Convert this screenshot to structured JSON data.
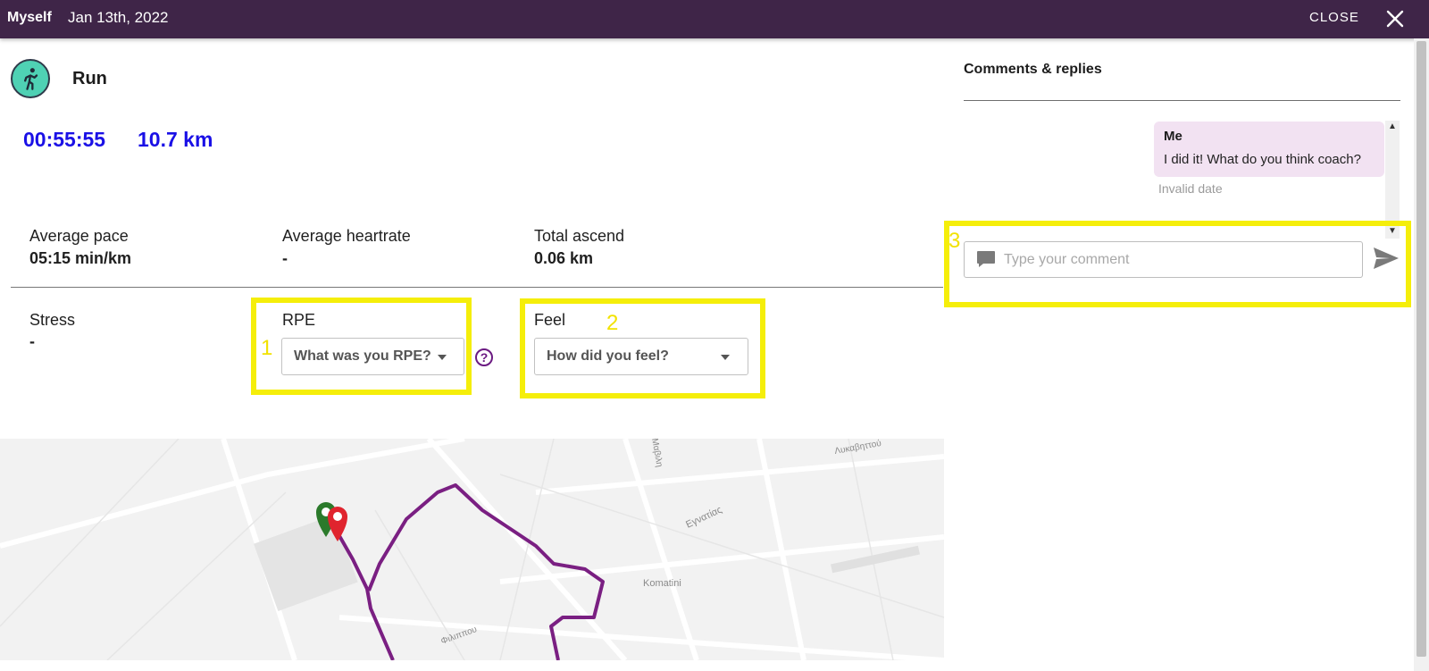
{
  "header": {
    "user": "Myself",
    "date": "Jan 13th, 2022",
    "close_label": "CLOSE"
  },
  "activity": {
    "title": "Run",
    "duration": "00:55:55",
    "distance": "10.7 km"
  },
  "stats": {
    "avg_pace_label": "Average pace",
    "avg_pace_value": "05:15 min/km",
    "avg_hr_label": "Average heartrate",
    "avg_hr_value": "-",
    "ascend_label": "Total ascend",
    "ascend_value": "0.06 km",
    "stress_label": "Stress",
    "stress_value": "-"
  },
  "rpe": {
    "label": "RPE",
    "placeholder": "What was you RPE?",
    "help": "?"
  },
  "feel": {
    "label": "Feel",
    "placeholder": "How did you feel?"
  },
  "annotations": [
    "1",
    "2",
    "3"
  ],
  "map": {
    "street_labels": [
      "Komatini",
      "Εγνατίας",
      "Λυκαβηττού",
      "Φιλιππου",
      "Μαβιλη"
    ]
  },
  "comments": {
    "title": "Comments & replies",
    "messages": [
      {
        "author": "Me",
        "text": "I did it! What do you think coach?",
        "date": "Invalid date"
      }
    ],
    "input_placeholder": "Type your comment"
  },
  "colors": {
    "header_bg": "#3f2548",
    "metric_blue": "#1a10e6",
    "route": "#7a1f82",
    "highlight": "#f5ee0a",
    "bubble_bg": "#f2e2f2"
  },
  "icons": [
    "run-icon",
    "close-icon",
    "help-icon",
    "comment-bubble-icon",
    "send-icon",
    "start-pin-icon",
    "end-pin-icon"
  ]
}
